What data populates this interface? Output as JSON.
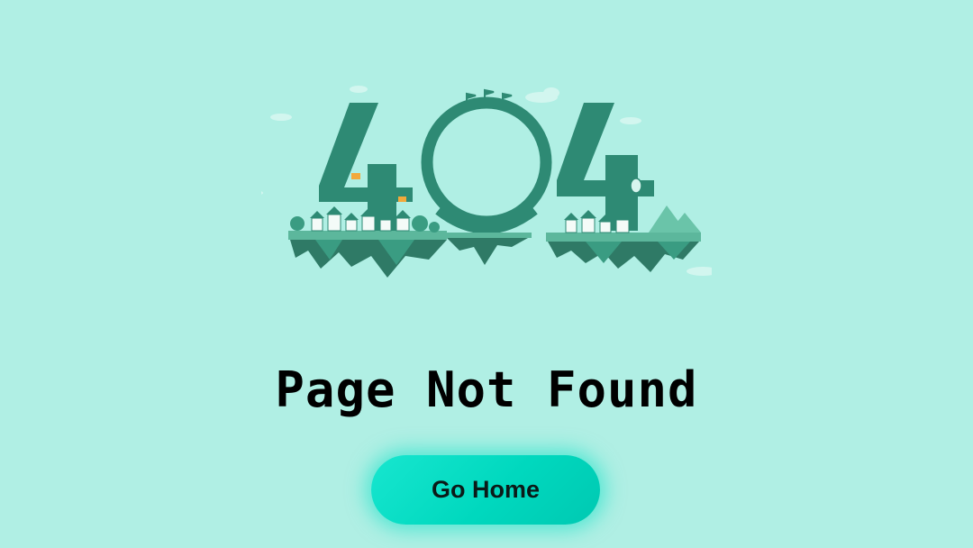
{
  "page": {
    "background_color": "#b0efe4",
    "title": "Page Not Found"
  },
  "illustration": {
    "digits": "404",
    "digit_color": "#2e8a74",
    "land_color": "#3a9c82",
    "accent_color": "#f2a93b"
  },
  "actions": {
    "home_label": "Go Home",
    "button_color": "#00dcc2"
  }
}
